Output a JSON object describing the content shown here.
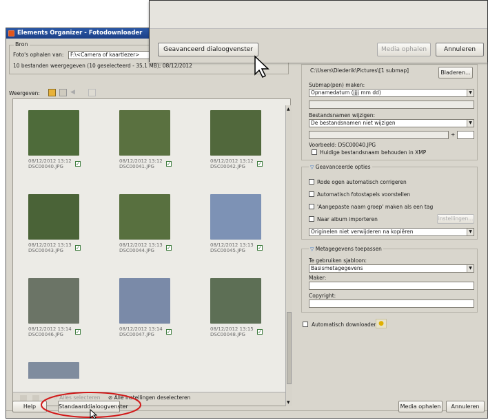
{
  "window": {
    "title": "Elements Organizer - Fotodownloader"
  },
  "source": {
    "legend": "Bron",
    "get_from_label": "Foto's ophalen van:",
    "get_from_value": "F:\\<Camera of kaartlezer>",
    "status_text": "10 bestanden weergegeven (10 geselecteerd - 35,1 MB); 08/12/2012"
  },
  "view": {
    "label": "Weergeven:",
    "select_all_label": "Alles selecteren",
    "deselect_all_label": "Alle instellingen deselecteren"
  },
  "photos": [
    {
      "date": "08/12/2012 13:12",
      "name": "DSC00040.JPG",
      "checked": true,
      "color": "#4e6b3a"
    },
    {
      "date": "08/12/2012 13:12",
      "name": "DSC00041.JPG",
      "checked": true,
      "color": "#5a7140"
    },
    {
      "date": "08/12/2012 13:12",
      "name": "DSC00042.JPG",
      "checked": true,
      "color": "#51683c"
    },
    {
      "date": "08/12/2012 13:13",
      "name": "DSC00043.JPG",
      "checked": true,
      "color": "#4a6337"
    },
    {
      "date": "08/12/2012 13:13",
      "name": "DSC00044.JPG",
      "checked": true,
      "color": "#58703f"
    },
    {
      "date": "08/12/2012 13:13",
      "name": "DSC00045.JPG",
      "checked": true,
      "color": "#7d92b5"
    },
    {
      "date": "08/12/2012 13:14",
      "name": "DSC00046.JPG",
      "checked": true,
      "color": "#6b7466"
    },
    {
      "date": "08/12/2012 13:14",
      "name": "DSC00047.JPG",
      "checked": true,
      "color": "#7a8aa8"
    },
    {
      "date": "08/12/2012 13:15",
      "name": "DSC00048.JPG",
      "checked": true,
      "color": "#5d6f55"
    },
    {
      "date": "",
      "name": "",
      "checked": false,
      "color": "#7f8c9e"
    }
  ],
  "destination": {
    "path": "C:\\Users\\Diederik\\Pictures\\[1 submap]",
    "browse_label": "Bladeren...",
    "subfolder_label": "Submap(pen) maken:",
    "subfolder_value": "Opnamedatum (jjjj mm dd)",
    "rename_label": "Bestandsnamen wijzigen:",
    "rename_value": "De bestandsnamen niet wijzigen",
    "plus": "+",
    "preview_text": "Voorbeeld: DSC00040.JPG",
    "keep_name_label": "Huidige bestandsnaam behouden in XMP"
  },
  "advanced": {
    "title": "Geavanceerde opties",
    "red_eye_label": "Rode ogen automatisch corrigeren",
    "stacks_label": "Automatisch fotostapels voorstellen",
    "group_tag_label": "'Aangepaste naam groep' maken als een tag",
    "album_label": "Naar album importeren",
    "settings_label": "Instellingen...",
    "delete_value": "Originelen niet verwijderen na kopiëren"
  },
  "metadata": {
    "title": "Metagegevens toepassen",
    "template_label": "Te gebruiken sjabloon:",
    "template_value": "Basismetagegevens",
    "maker_label": "Maker:",
    "copyright_label": "Copyright:"
  },
  "auto_download": {
    "label": "Automatisch downloaden"
  },
  "footer": {
    "help_label": "Help",
    "standard_dialog_label": "Standaarddialoogvenster",
    "get_media_label": "Media ophalen",
    "cancel_label": "Annuleren"
  },
  "overlay": {
    "advanced_dialog_label": "Geavanceerd dialoogvenster",
    "get_media_label": "Media ophalen",
    "cancel_label": "Annuleren"
  },
  "colors": {
    "accent": "#2b59a8",
    "highlight_circle": "#d11a1a"
  }
}
